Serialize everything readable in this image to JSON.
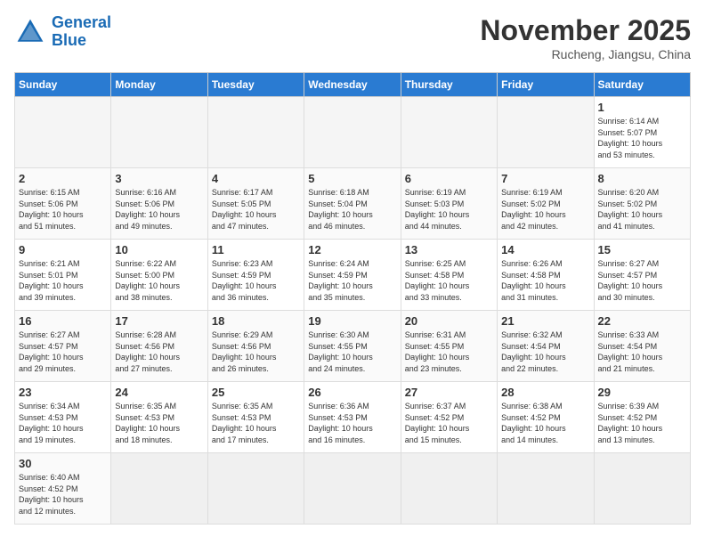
{
  "header": {
    "logo_general": "General",
    "logo_blue": "Blue",
    "month_title": "November 2025",
    "location": "Rucheng, Jiangsu, China"
  },
  "days_of_week": [
    "Sunday",
    "Monday",
    "Tuesday",
    "Wednesday",
    "Thursday",
    "Friday",
    "Saturday"
  ],
  "weeks": [
    [
      {
        "day": "",
        "info": ""
      },
      {
        "day": "",
        "info": ""
      },
      {
        "day": "",
        "info": ""
      },
      {
        "day": "",
        "info": ""
      },
      {
        "day": "",
        "info": ""
      },
      {
        "day": "",
        "info": ""
      },
      {
        "day": "1",
        "info": "Sunrise: 6:14 AM\nSunset: 5:07 PM\nDaylight: 10 hours\nand 53 minutes."
      }
    ],
    [
      {
        "day": "2",
        "info": "Sunrise: 6:15 AM\nSunset: 5:06 PM\nDaylight: 10 hours\nand 51 minutes."
      },
      {
        "day": "3",
        "info": "Sunrise: 6:16 AM\nSunset: 5:06 PM\nDaylight: 10 hours\nand 49 minutes."
      },
      {
        "day": "4",
        "info": "Sunrise: 6:17 AM\nSunset: 5:05 PM\nDaylight: 10 hours\nand 47 minutes."
      },
      {
        "day": "5",
        "info": "Sunrise: 6:18 AM\nSunset: 5:04 PM\nDaylight: 10 hours\nand 46 minutes."
      },
      {
        "day": "6",
        "info": "Sunrise: 6:19 AM\nSunset: 5:03 PM\nDaylight: 10 hours\nand 44 minutes."
      },
      {
        "day": "7",
        "info": "Sunrise: 6:19 AM\nSunset: 5:02 PM\nDaylight: 10 hours\nand 42 minutes."
      },
      {
        "day": "8",
        "info": "Sunrise: 6:20 AM\nSunset: 5:02 PM\nDaylight: 10 hours\nand 41 minutes."
      }
    ],
    [
      {
        "day": "9",
        "info": "Sunrise: 6:21 AM\nSunset: 5:01 PM\nDaylight: 10 hours\nand 39 minutes."
      },
      {
        "day": "10",
        "info": "Sunrise: 6:22 AM\nSunset: 5:00 PM\nDaylight: 10 hours\nand 38 minutes."
      },
      {
        "day": "11",
        "info": "Sunrise: 6:23 AM\nSunset: 4:59 PM\nDaylight: 10 hours\nand 36 minutes."
      },
      {
        "day": "12",
        "info": "Sunrise: 6:24 AM\nSunset: 4:59 PM\nDaylight: 10 hours\nand 35 minutes."
      },
      {
        "day": "13",
        "info": "Sunrise: 6:25 AM\nSunset: 4:58 PM\nDaylight: 10 hours\nand 33 minutes."
      },
      {
        "day": "14",
        "info": "Sunrise: 6:26 AM\nSunset: 4:58 PM\nDaylight: 10 hours\nand 31 minutes."
      },
      {
        "day": "15",
        "info": "Sunrise: 6:27 AM\nSunset: 4:57 PM\nDaylight: 10 hours\nand 30 minutes."
      }
    ],
    [
      {
        "day": "16",
        "info": "Sunrise: 6:27 AM\nSunset: 4:57 PM\nDaylight: 10 hours\nand 29 minutes."
      },
      {
        "day": "17",
        "info": "Sunrise: 6:28 AM\nSunset: 4:56 PM\nDaylight: 10 hours\nand 27 minutes."
      },
      {
        "day": "18",
        "info": "Sunrise: 6:29 AM\nSunset: 4:56 PM\nDaylight: 10 hours\nand 26 minutes."
      },
      {
        "day": "19",
        "info": "Sunrise: 6:30 AM\nSunset: 4:55 PM\nDaylight: 10 hours\nand 24 minutes."
      },
      {
        "day": "20",
        "info": "Sunrise: 6:31 AM\nSunset: 4:55 PM\nDaylight: 10 hours\nand 23 minutes."
      },
      {
        "day": "21",
        "info": "Sunrise: 6:32 AM\nSunset: 4:54 PM\nDaylight: 10 hours\nand 22 minutes."
      },
      {
        "day": "22",
        "info": "Sunrise: 6:33 AM\nSunset: 4:54 PM\nDaylight: 10 hours\nand 21 minutes."
      }
    ],
    [
      {
        "day": "23",
        "info": "Sunrise: 6:34 AM\nSunset: 4:53 PM\nDaylight: 10 hours\nand 19 minutes."
      },
      {
        "day": "24",
        "info": "Sunrise: 6:35 AM\nSunset: 4:53 PM\nDaylight: 10 hours\nand 18 minutes."
      },
      {
        "day": "25",
        "info": "Sunrise: 6:35 AM\nSunset: 4:53 PM\nDaylight: 10 hours\nand 17 minutes."
      },
      {
        "day": "26",
        "info": "Sunrise: 6:36 AM\nSunset: 4:53 PM\nDaylight: 10 hours\nand 16 minutes."
      },
      {
        "day": "27",
        "info": "Sunrise: 6:37 AM\nSunset: 4:52 PM\nDaylight: 10 hours\nand 15 minutes."
      },
      {
        "day": "28",
        "info": "Sunrise: 6:38 AM\nSunset: 4:52 PM\nDaylight: 10 hours\nand 14 minutes."
      },
      {
        "day": "29",
        "info": "Sunrise: 6:39 AM\nSunset: 4:52 PM\nDaylight: 10 hours\nand 13 minutes."
      }
    ],
    [
      {
        "day": "30",
        "info": "Sunrise: 6:40 AM\nSunset: 4:52 PM\nDaylight: 10 hours\nand 12 minutes."
      },
      {
        "day": "",
        "info": ""
      },
      {
        "day": "",
        "info": ""
      },
      {
        "day": "",
        "info": ""
      },
      {
        "day": "",
        "info": ""
      },
      {
        "day": "",
        "info": ""
      },
      {
        "day": "",
        "info": ""
      }
    ]
  ]
}
